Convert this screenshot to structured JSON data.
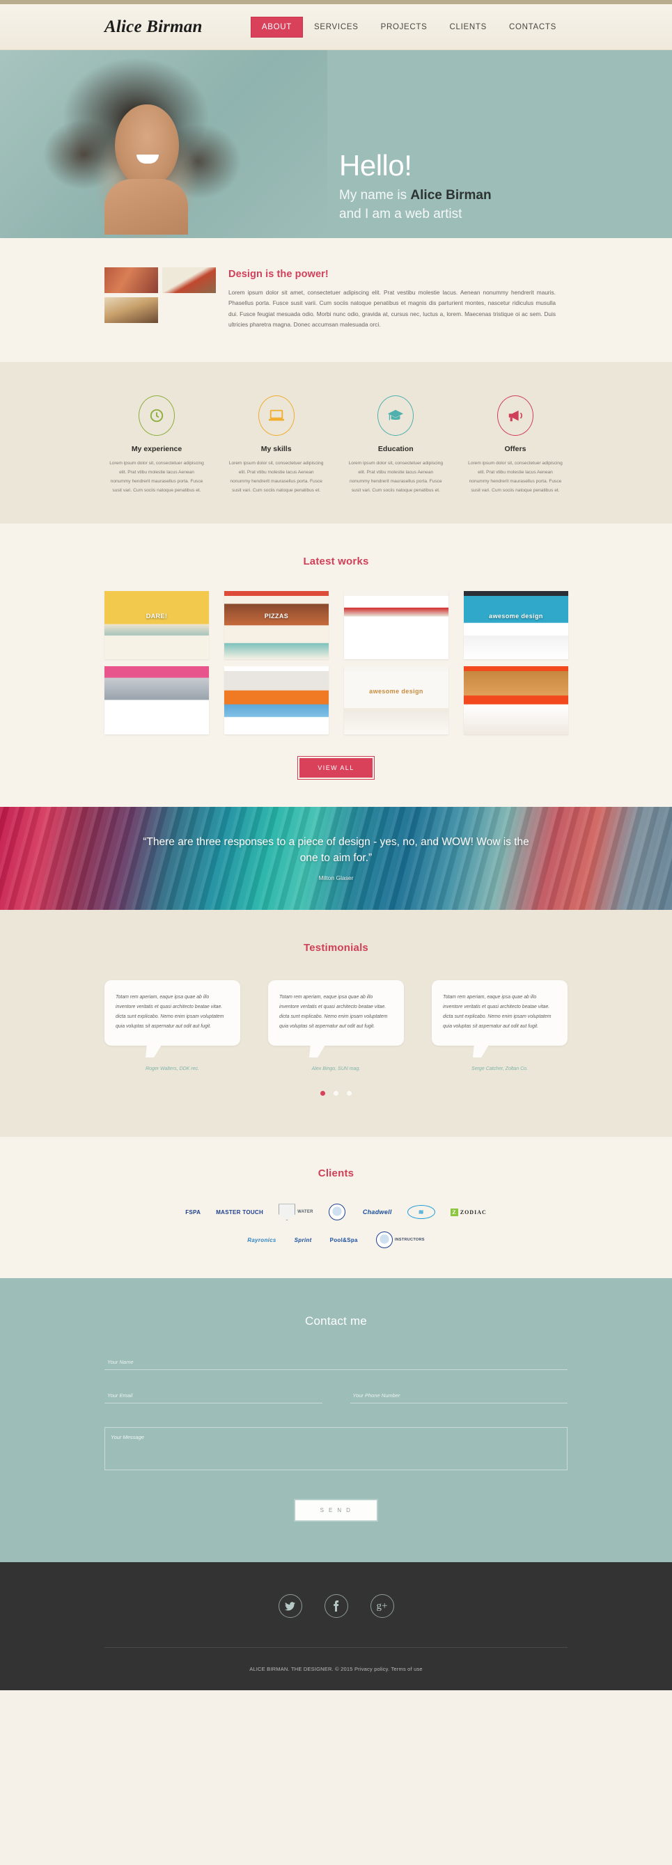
{
  "site": {
    "logo": "Alice Birman",
    "accent": "#d9405a",
    "teal": "#9dbdb8",
    "cream": "#f7f3ea",
    "beige": "#ece6d8"
  },
  "nav": {
    "items": [
      {
        "label": "ABOUT",
        "active": true
      },
      {
        "label": "SERVICES",
        "active": false
      },
      {
        "label": "PROJECTS",
        "active": false
      },
      {
        "label": "CLIENTS",
        "active": false
      },
      {
        "label": "CONTACTS",
        "active": false
      }
    ]
  },
  "hero": {
    "greeting": "Hello!",
    "line1_prefix": "My name is ",
    "line1_name": "Alice Birman",
    "line2": "and I am a web artist"
  },
  "about": {
    "title": "Design is the power!",
    "body": "Lorem ipsum dolor sit amet, consectetuer adipiscing elit. Prat vestibu molestie lacus. Aenean nonummy hendrerit mauris. Phasellus porta. Fusce susit varii. Cum sociis natoque penatibus et magnis dis parturient montes, nascetur ridiculus musulla dui. Fusce feugiat mesuada odio. Morbi nunc odio, gravida at, cursus nec, luctus a, lorem. Maecenas tristique oi ac sem. Duis ultricies pharetra magna. Donec accumsan malesuada orci.",
    "thumbnails": [
      "canyon-photo",
      "laptop-coffee-photo",
      "dog-photo"
    ]
  },
  "features": {
    "body_text": "Lorem ipsum dolor sit, consectetuer adipiscing elit. Prat vtibu molestie lacus Aenean nonummy hendrerit maurasellus porta. Fusce susit vari. Cum sociis natoque penatibus et.",
    "items": [
      {
        "title": "My experience",
        "icon": "clock-icon",
        "color": "#8cae3b"
      },
      {
        "title": "My skills",
        "icon": "laptop-icon",
        "color": "#f0ad2e"
      },
      {
        "title": "Education",
        "icon": "graduation-icon",
        "color": "#4fb0ae"
      },
      {
        "title": "Offers",
        "icon": "megaphone-icon",
        "color": "#cf3f57"
      }
    ]
  },
  "works": {
    "title": "Latest works",
    "view_all": "VIEW ALL",
    "items": [
      {
        "name": "dare-travel-site",
        "label": "DARE!"
      },
      {
        "name": "pizzas-restaurant-site",
        "label": "PIZZAS"
      },
      {
        "name": "corporate-red-site",
        "label": ""
      },
      {
        "name": "awesome-design-site",
        "label": "awesome design"
      },
      {
        "name": "pink-architecture-site",
        "label": ""
      },
      {
        "name": "orange-support-site",
        "label": ""
      },
      {
        "name": "balloons-awesome-site",
        "label": "awesome design"
      },
      {
        "name": "burger-food-site",
        "label": ""
      }
    ]
  },
  "quote": {
    "text": "“There are three responses to a piece of design - yes, no, and WOW! Wow is the one to aim for.”",
    "author": "Milton Glaser"
  },
  "testimonials": {
    "title": "Testimonials",
    "items": [
      {
        "text": "Totam rem aperiam, eaque ipsa quae ab illo inventore veritatis et quasi architecto beatae vitae. dicta sunt explicabo. Nemo enim ipsam voluptatem quia voluptas sit aspernatur aut odit aut fugit.",
        "author": "Roger Walters, DDK rec."
      },
      {
        "text": "Totam rem aperiam, eaque ipsa quae ab illo inventore veritatis et quasi architecto beatae vitae. dicta sunt explicabo. Nemo enim ipsam voluptatem quia voluptas sit aspernatur aut odit aut fugit.",
        "author": "Alex Bingo, SUN mag."
      },
      {
        "text": "Totam rem aperiam, eaque ipsa quae ab illo inventore veritatis et quasi architecto beatae vitae. dicta sunt explicabo. Nemo enim ipsam voluptatem quia voluptas sit aspernatur aut odit aut fugit.",
        "author": "Serge Catcher, Zoltan Co."
      }
    ],
    "dots": [
      true,
      false,
      false
    ]
  },
  "clients": {
    "title": "Clients",
    "row1": [
      {
        "name": "fspa-logo",
        "label": "FSPA"
      },
      {
        "name": "master-touch-logo",
        "label": "MASTER TOUCH"
      },
      {
        "name": "shield-logo",
        "label": "WATER"
      },
      {
        "name": "circle-seal-logo",
        "label": ""
      },
      {
        "name": "chadwell-logo",
        "label": "Chadwell"
      },
      {
        "name": "wave-oval-logo",
        "label": ""
      },
      {
        "name": "zodiac-logo",
        "label": "ZODIAC"
      }
    ],
    "row2": [
      {
        "name": "rayronics-logo",
        "label": "Rayronics"
      },
      {
        "name": "sprint-logo",
        "label": "Sprint"
      },
      {
        "name": "pool-spa-logo",
        "label": "Pool&Spa"
      },
      {
        "name": "instructors-logo",
        "label": "INSTRUCTORS"
      }
    ]
  },
  "contact": {
    "title": "Contact me",
    "name_placeholder": "Your Name",
    "email_placeholder": "Your Email",
    "phone_placeholder": "Your Phone Number",
    "message_placeholder": "Your Message",
    "send_label": "S E N D"
  },
  "footer": {
    "socials": [
      {
        "name": "twitter-icon",
        "glyph": "🐦"
      },
      {
        "name": "facebook-icon",
        "glyph": "f"
      },
      {
        "name": "googleplus-icon",
        "glyph": "g+"
      }
    ],
    "copyright": "ALICE BIRMAN. THE DESIGNER. © 2015 Privacy policy. Terms of use"
  }
}
